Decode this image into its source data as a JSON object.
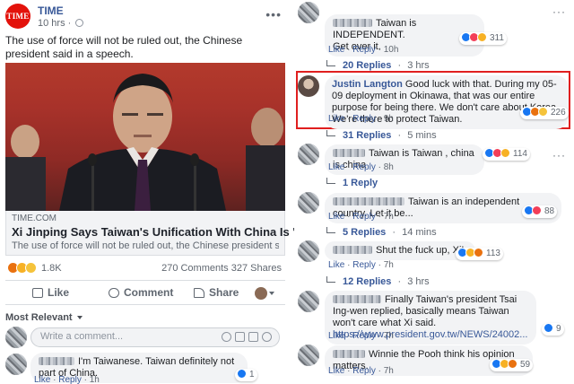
{
  "post": {
    "page_name": "TIME",
    "logo_text": "TIME",
    "time": "10 hrs",
    "text": "The use of force will not be ruled out, the Chinese president said in a speech.",
    "link": {
      "domain": "TIME.COM",
      "title": "Xi Jinping Says Taiwan's Unification With China Is 'Inevitable'",
      "description": "The use of force will not be ruled out, the Chinese president said in a speech"
    },
    "reactions_count": "1.8K",
    "comments_shares": "270 Comments  327 Shares",
    "actions": {
      "like": "Like",
      "comment": "Comment",
      "share": "Share"
    },
    "sort_label": "Most Relevant",
    "write_placeholder": "Write a comment...",
    "first_comment": {
      "text": "I'm Taiwanese. Taiwan definitely not part of China.",
      "meta": {
        "like": "Like",
        "reply": "Reply",
        "time": "1h"
      },
      "reactions": "1"
    }
  },
  "comments": [
    {
      "text": "Taiwan is INDEPENDENT.",
      "text2": "Get over it.",
      "like": "Like",
      "reply": "Reply",
      "time": "10h",
      "reactions": "311",
      "replies": "20 Replies",
      "replies_time": "3 hrs"
    },
    {
      "author": "Justin Langton",
      "text": "Good luck with that. During my 05-09 deployment in Okinawa, that was our entire purpose for being there. We don't care about Korea. We're there to protect Taiwan.",
      "like": "Like",
      "reply": "Reply",
      "time": "9h",
      "reactions": "226",
      "replies": "31 Replies",
      "replies_time": "5 mins"
    },
    {
      "text": "Taiwan is Taiwan , china is china",
      "like": "Like",
      "reply": "Reply",
      "time": "8h",
      "reactions": "114",
      "replies": "1 Reply",
      "replies_time": ""
    },
    {
      "text": "Taiwan is an independent country. Let it be...",
      "like": "Like",
      "reply": "Reply",
      "time": "7h",
      "reactions": "88",
      "replies": "5 Replies",
      "replies_time": "14 mins"
    },
    {
      "text": "Shut the fuck up, Xi!",
      "like": "Like",
      "reply": "Reply",
      "time": "7h",
      "reactions": "113",
      "replies": "12 Replies",
      "replies_time": "3 hrs"
    },
    {
      "text": "Finally Taiwan's president Tsai Ing-wen replied, basically means Taiwan won't care what Xi said.",
      "link": "https://www.president.gov.tw/NEWS/24002...",
      "like": "Like",
      "reply": "Reply",
      "time": "7h",
      "reactions": "9"
    },
    {
      "text": "Winnie the Pooh think his opinion matters.",
      "like": "Like",
      "reply": "Reply",
      "time": "7h",
      "reactions": "59"
    }
  ],
  "colors": {
    "time_red": "#e3120b",
    "link_blue": "#385898",
    "highlight_red": "#e01f1f",
    "bubble_grey": "#f2f3f5"
  }
}
